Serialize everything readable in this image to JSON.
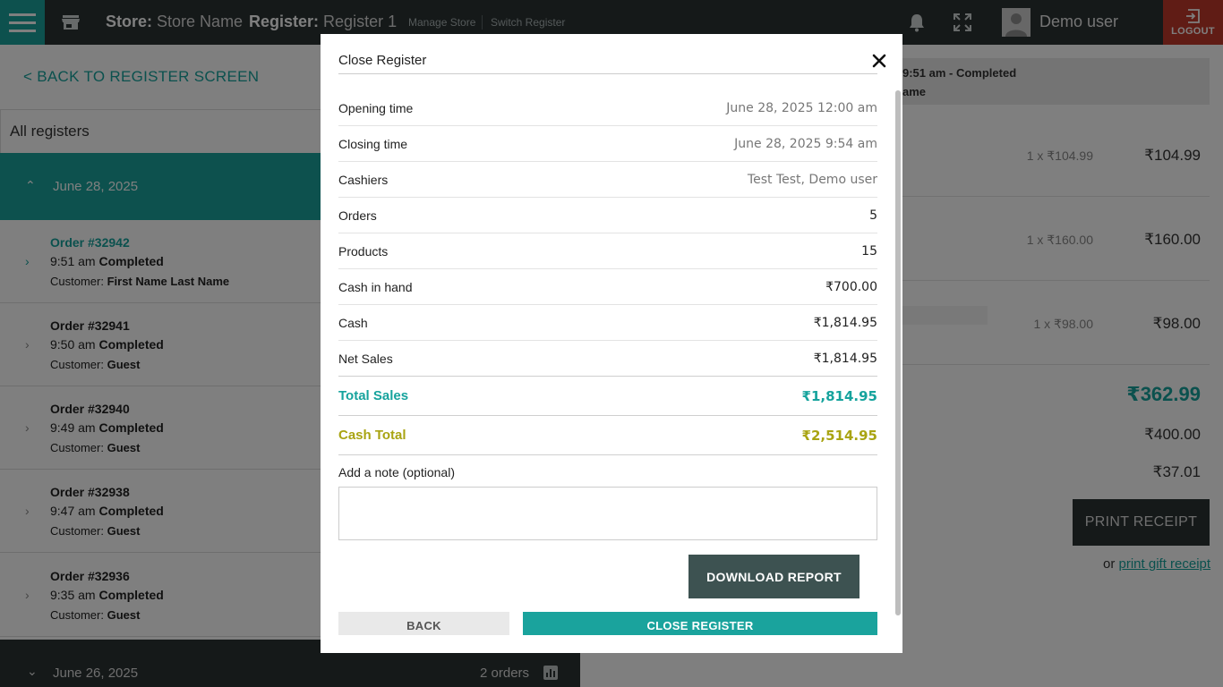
{
  "topbar": {
    "store_label": "Store:",
    "store_name": "Store Name",
    "register_label": "Register:",
    "register_name": "Register 1",
    "manage_store": "Manage Store",
    "switch_register": "Switch Register",
    "user_name": "Demo user",
    "logout": "LOGOUT"
  },
  "left": {
    "back_link": "< BACK TO REGISTER SCREEN",
    "register_filter": "All registers",
    "date_group": "June 28, 2025",
    "orders": [
      {
        "number": "Order #32942",
        "time": "9:51 am",
        "status": "Completed",
        "customer_label": "Customer:",
        "customer": "First Name Last Name"
      },
      {
        "number": "Order #32941",
        "time": "9:50 am",
        "status": "Completed",
        "customer_label": "Customer:",
        "customer": "Guest"
      },
      {
        "number": "Order #32940",
        "time": "9:49 am",
        "status": "Completed",
        "customer_label": "Customer:",
        "customer": "Guest"
      },
      {
        "number": "Order #32938",
        "time": "9:47 am",
        "status": "Completed",
        "customer_label": "Customer:",
        "customer": "Guest"
      },
      {
        "number": "Order #32936",
        "time": "9:35 am",
        "status": "Completed",
        "customer_label": "Customer:",
        "customer": "Guest"
      }
    ],
    "date_group_2": "June 26, 2025",
    "date_group_2_count": "2 orders"
  },
  "right": {
    "header_line1": "9:51 am  -  Completed",
    "header_line2": "ame",
    "lines": [
      {
        "qty": "1 x ₹104.99",
        "price": "₹104.99"
      },
      {
        "qty": "1 x ₹160.00",
        "price": "₹160.00"
      },
      {
        "qty": "1 x ₹98.00",
        "price": "₹98.00"
      }
    ],
    "total": "₹362.99",
    "paid": "₹400.00",
    "change": "₹37.01",
    "print_receipt": "PRINT RECEIPT",
    "gift_prefix": "or",
    "gift_link": "print gift receipt"
  },
  "modal": {
    "title": "Close Register",
    "rows": [
      {
        "label": "Opening time",
        "value": "June 28, 2025 12:00 am"
      },
      {
        "label": "Closing time",
        "value": "June 28, 2025 9:54 am"
      },
      {
        "label": "Cashiers",
        "value": "Test Test, Demo user"
      },
      {
        "label": "Orders",
        "value": "5"
      },
      {
        "label": "Products",
        "value": "15"
      },
      {
        "label": "Cash in hand",
        "value": "₹700.00"
      },
      {
        "label": "Cash",
        "value": "₹1,814.95"
      },
      {
        "label": "Net Sales",
        "value": "₹1,814.95"
      }
    ],
    "total_sales_label": "Total Sales",
    "total_sales_value": "₹1,814.95",
    "cash_total_label": "Cash Total",
    "cash_total_value": "₹2,514.95",
    "note_label": "Add a note (optional)",
    "note_value": "",
    "download_report": "DOWNLOAD REPORT",
    "back": "BACK",
    "close_register": "CLOSE REGISTER"
  },
  "colors": {
    "accent": "#1aa39d",
    "dark": "#2b3233",
    "cash_total": "#a9a412",
    "logout": "#c0392b"
  }
}
